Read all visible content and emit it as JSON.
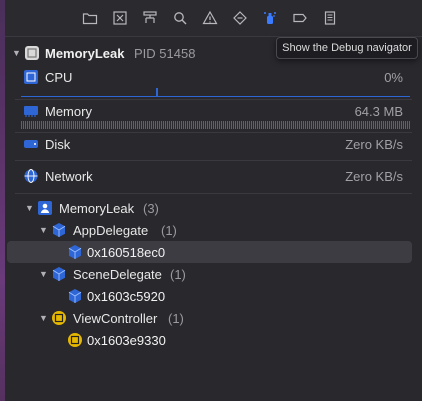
{
  "toolbar": {
    "icons": [
      "folder-icon",
      "x-square-icon",
      "hierarchy-icon",
      "search-icon",
      "warning-icon",
      "diamond-icon",
      "debug-spray-icon",
      "tag-icon",
      "report-icon"
    ]
  },
  "tooltip": "Show the Debug navigator",
  "process": {
    "name": "MemoryLeak",
    "pid": "PID 51458"
  },
  "gauges": {
    "cpu": {
      "label": "CPU",
      "value": "0%"
    },
    "memory": {
      "label": "Memory",
      "value": "64.3 MB"
    },
    "disk": {
      "label": "Disk",
      "value": "Zero KB/s"
    },
    "network": {
      "label": "Network",
      "value": "Zero KB/s"
    }
  },
  "tree": {
    "root": {
      "label": "MemoryLeak",
      "count": "(3)"
    },
    "groups": [
      {
        "label": "AppDelegate",
        "count": "(1)",
        "instance": "0x160518ec0"
      },
      {
        "label": "SceneDelegate",
        "count": "(1)",
        "instance": "0x1603c5920"
      },
      {
        "label": "ViewController",
        "count": "(1)",
        "instance": "0x1603e9330"
      }
    ]
  },
  "colors": {
    "accent": "#2f66d6",
    "selection": "#3d3c43",
    "viewcontroller": "#e6b800"
  }
}
